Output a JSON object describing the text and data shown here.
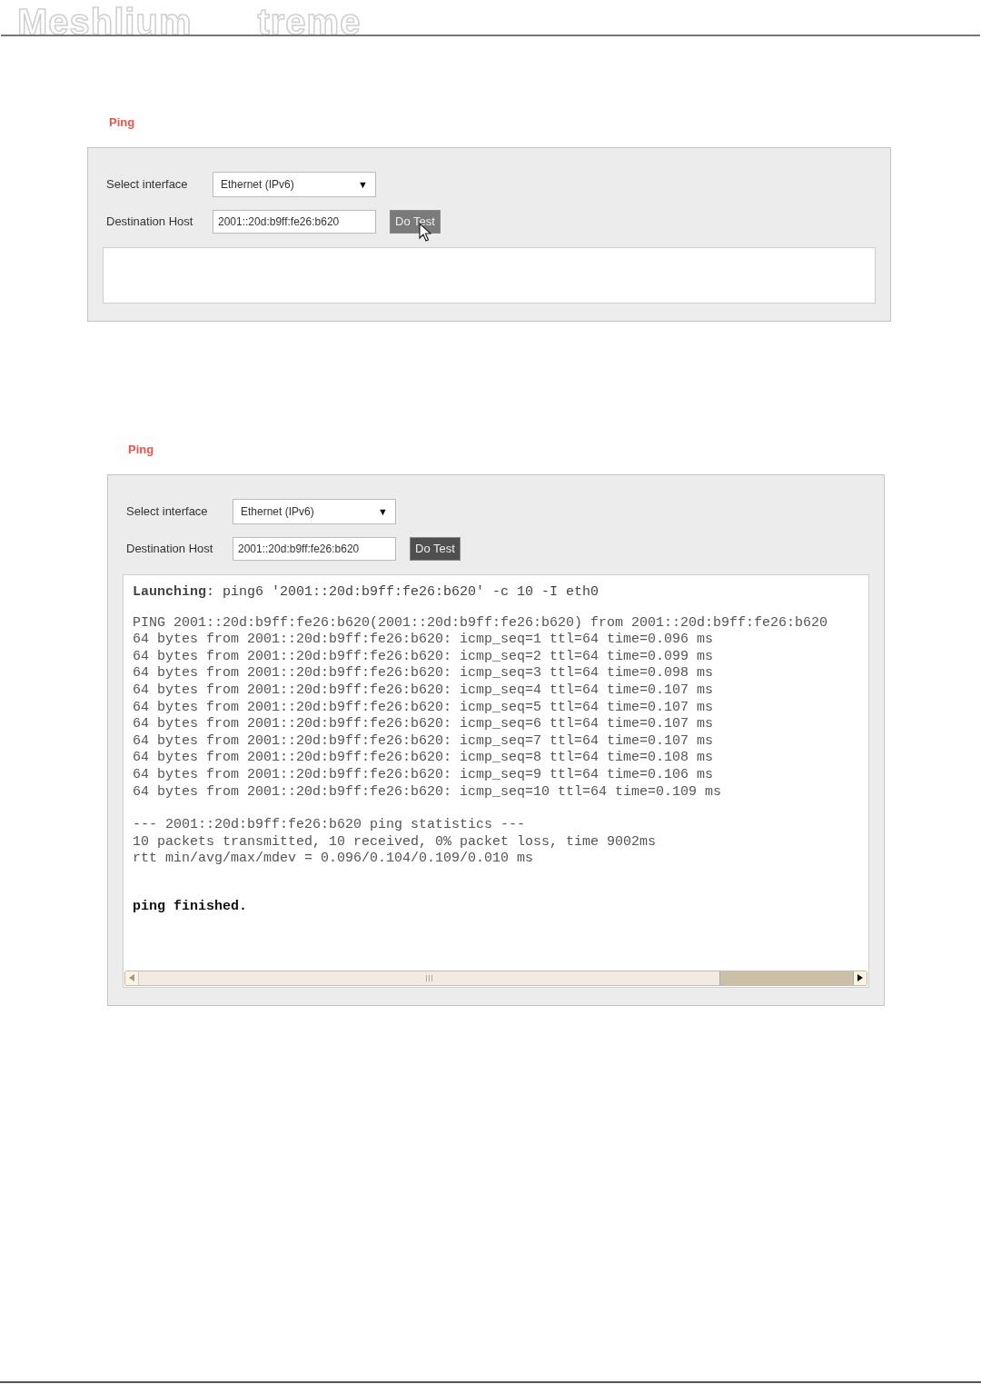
{
  "header": {
    "logo_left": "Meshlium",
    "logo_right": "treme"
  },
  "screenshots": [
    {
      "title": "Ping",
      "interface_label": "Select interface",
      "interface_value": "Ethernet (IPv6)",
      "dropdown_arrow": "▼",
      "host_label": "Destination Host",
      "host_value": "2001::20d:b9ff:fe26:b620",
      "button": {
        "label": "Do Test",
        "hovered": true
      },
      "horizontal_scrollbar": false
    },
    {
      "title": "Ping",
      "interface_label": "Select interface",
      "interface_value": "Ethernet (IPv6)",
      "dropdown_arrow": "▼",
      "host_label": "Destination Host",
      "host_value": "2001::20d:b9ff:fe26:b620",
      "button": {
        "label": "Do Test",
        "hovered": false
      },
      "horizontal_scrollbar": true,
      "output": [
        {
          "kind": "message",
          "lines": [
            "**Launching**: ping6 '2001::20d:b9ff:fe26:b620' -c 10 -I eth0"
          ]
        },
        {
          "kind": "log",
          "lines": [
            "PING 2001::20d:b9ff:fe26:b620(2001::20d:b9ff:fe26:b620) from 2001::20d:b9ff:fe26:b620",
            "64 bytes from 2001::20d:b9ff:fe26:b620: icmp_seq=1 ttl=64 time=0.096 ms",
            "64 bytes from 2001::20d:b9ff:fe26:b620: icmp_seq=2 ttl=64 time=0.099 ms",
            "64 bytes from 2001::20d:b9ff:fe26:b620: icmp_seq=3 ttl=64 time=0.098 ms",
            "64 bytes from 2001::20d:b9ff:fe26:b620: icmp_seq=4 ttl=64 time=0.107 ms",
            "64 bytes from 2001::20d:b9ff:fe26:b620: icmp_seq=5 ttl=64 time=0.107 ms",
            "64 bytes from 2001::20d:b9ff:fe26:b620: icmp_seq=6 ttl=64 time=0.107 ms",
            "64 bytes from 2001::20d:b9ff:fe26:b620: icmp_seq=7 ttl=64 time=0.107 ms",
            "64 bytes from 2001::20d:b9ff:fe26:b620: icmp_seq=8 ttl=64 time=0.108 ms",
            "64 bytes from 2001::20d:b9ff:fe26:b620: icmp_seq=9 ttl=64 time=0.106 ms",
            "64 bytes from 2001::20d:b9ff:fe26:b620: icmp_seq=10 ttl=64 time=0.109 ms"
          ]
        },
        {
          "kind": "log",
          "lines": [
            "--- 2001::20d:b9ff:fe26:b620 ping statistics ---",
            "10 packets transmitted, 10 received, 0% packet loss, time 9002ms",
            "rtt min/avg/max/mdev = 0.096/0.104/0.109/0.010 ms"
          ]
        },
        {
          "kind": "status",
          "lines": [
            "ping finished."
          ]
        }
      ]
    }
  ]
}
